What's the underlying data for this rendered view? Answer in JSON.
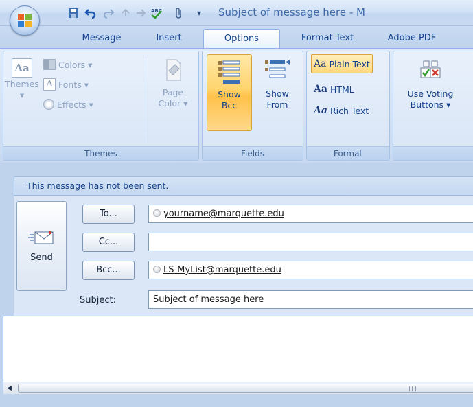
{
  "window": {
    "title": "Subject of message here - M"
  },
  "quick_access_toolbar": {
    "icons": [
      "save-icon",
      "undo-icon",
      "redo-icon",
      "previous-item-icon",
      "next-item-icon",
      "spelling-icon",
      "attach-file-icon",
      "customize-toolbar-icon"
    ],
    "customize_glyph": "▾"
  },
  "tabs": [
    {
      "label": "Message",
      "active": false
    },
    {
      "label": "Insert",
      "active": false
    },
    {
      "label": "Options",
      "active": true
    },
    {
      "label": "Format Text",
      "active": false
    },
    {
      "label": "Adobe PDF",
      "active": false
    }
  ],
  "ribbon": {
    "themes_group": {
      "label": "Themes",
      "themes_button": "Themes",
      "colors_button": "Colors",
      "fonts_button": "Fonts",
      "effects_button": "Effects",
      "page_color_line1": "Page",
      "page_color_line2": "Color",
      "dropdown_glyph": "▾",
      "theme_icon_text": "Aa",
      "fonts_icon_text": "A"
    },
    "fields_group": {
      "label": "Fields",
      "show_bcc_line1": "Show",
      "show_bcc_line2": "Bcc",
      "show_bcc_active": true,
      "show_from_line1": "Show",
      "show_from_line2": "From"
    },
    "format_group": {
      "label": "Format",
      "glyph": "Aa",
      "plain_text": "Plain Text",
      "html": "HTML",
      "rich_text": "Rich Text",
      "selected": "plain_text"
    },
    "voting_group": {
      "line1": "Use Voting",
      "line2": "Buttons"
    }
  },
  "info_bar": {
    "text": "This message has not been sent."
  },
  "compose": {
    "send_button": "Send",
    "to_button": "To...",
    "cc_button": "Cc...",
    "bcc_button": "Bcc...",
    "to_value": "yourname@marquette.edu",
    "cc_value": "",
    "bcc_value": "LS-MyList@marquette.edu",
    "subject_label": "Subject:",
    "subject_value": "Subject of message here"
  },
  "body": {
    "text": ""
  },
  "colors": {
    "frame": "#bfd3ec",
    "ribbon_text": "#15428b",
    "active_button": "#ffd46d",
    "info_bar": "#c4d8f1"
  }
}
